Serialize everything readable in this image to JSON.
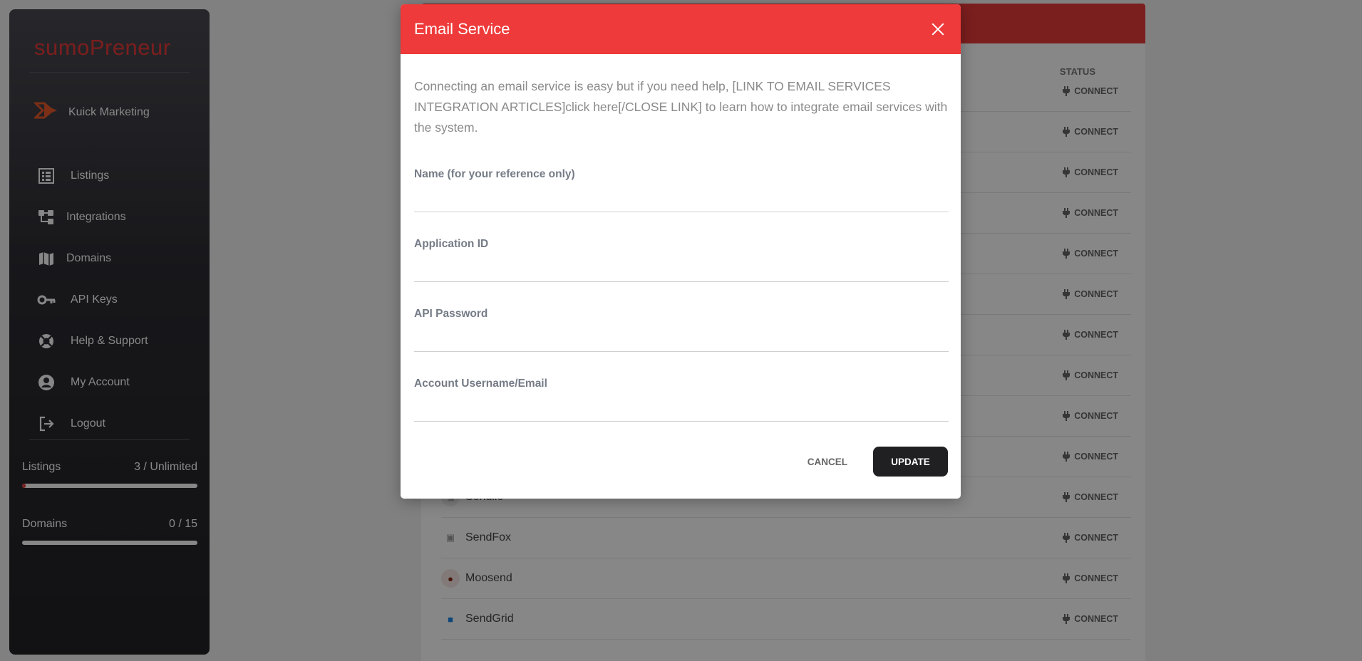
{
  "sidebar": {
    "logo_part1": "sumo",
    "logo_part2": "Preneur",
    "brand": "Kuick Marketing",
    "nav": [
      {
        "label": "Listings",
        "icon": "list-icon"
      },
      {
        "label": "Integrations",
        "icon": "integrations-icon"
      },
      {
        "label": "Domains",
        "icon": "map-icon"
      },
      {
        "label": "API Keys",
        "icon": "key-icon"
      },
      {
        "label": "Help & Support",
        "icon": "lifebuoy-icon"
      },
      {
        "label": "My Account",
        "icon": "user-icon"
      },
      {
        "label": "Logout",
        "icon": "logout-icon"
      }
    ],
    "stats": [
      {
        "label": "Listings",
        "value": "3 / Unlimited",
        "fill_fraction": 0.02
      },
      {
        "label": "Domains",
        "value": "0 / 15",
        "fill_fraction": 0
      }
    ]
  },
  "panel": {
    "status_header": "STATUS",
    "connect_label": "CONNECT",
    "rows": [
      {
        "name": ""
      },
      {
        "name": ""
      },
      {
        "name": ""
      },
      {
        "name": ""
      },
      {
        "name": ""
      },
      {
        "name": ""
      },
      {
        "name": ""
      },
      {
        "name": ""
      },
      {
        "name": ""
      },
      {
        "name": ""
      },
      {
        "name": "Sendiio"
      },
      {
        "name": "SendFox"
      },
      {
        "name": "Moosend"
      },
      {
        "name": "SendGrid"
      }
    ]
  },
  "modal": {
    "title": "Email Service",
    "intro": "Connecting an email service is easy but if you need help, [LINK TO EMAIL SERVICES INTEGRATION ARTICLES]click here[/CLOSE LINK] to learn how to integrate email services with the system.",
    "fields": [
      {
        "label": "Name (for your reference only)",
        "value": ""
      },
      {
        "label": "Application ID",
        "value": ""
      },
      {
        "label": "API Password",
        "value": ""
      },
      {
        "label": "Account Username/Email",
        "value": ""
      }
    ],
    "cancel_label": "CANCEL",
    "update_label": "UPDATE"
  },
  "colors": {
    "accent": "#ee3a3a",
    "sidebar": "#2d2d33",
    "dark_button": "#202022"
  }
}
